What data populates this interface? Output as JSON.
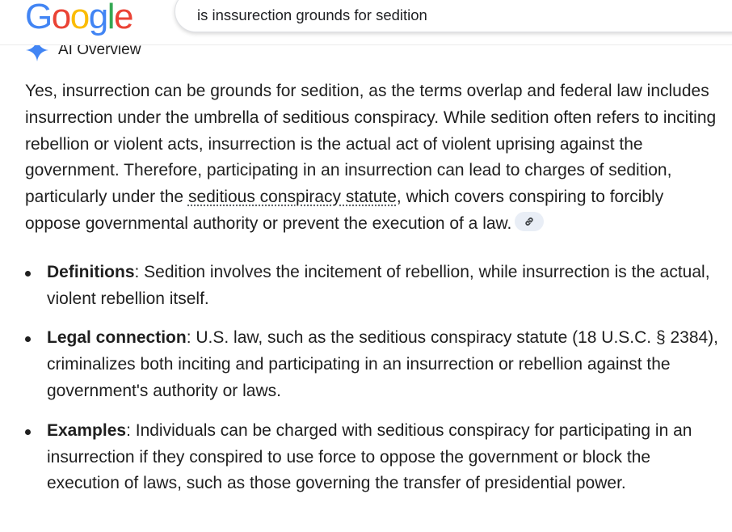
{
  "logo": {
    "letters": [
      {
        "char": "G",
        "color": "#4285F4"
      },
      {
        "char": "o",
        "color": "#EA4335"
      },
      {
        "char": "o",
        "color": "#FBBC05"
      },
      {
        "char": "g",
        "color": "#4285F4"
      },
      {
        "char": "l",
        "color": "#34A853"
      },
      {
        "char": "e",
        "color": "#EA4335"
      }
    ]
  },
  "search": {
    "query": "is inssurection grounds for sedition"
  },
  "ai_overview": {
    "title": "AI Overview",
    "icon": "sparkle-icon",
    "intro": {
      "text_before": "Yes, insurrection can be grounds for sedition, as the terms overlap and federal law includes insurrection under the umbrella of seditious conspiracy. While sedition often refers to inciting rebellion or violent acts, insurrection is the actual act of violent uprising against the government. Therefore, participating in an insurrection can lead to charges of sedition, particularly under the ",
      "link_text": "seditious conspiracy statute",
      "text_after": ", which covers conspiring to forcibly oppose governmental authority or prevent the execution of a law.",
      "chip_icon": "link-icon"
    },
    "bullets": [
      {
        "term": "Definitions",
        "text": ": Sedition involves the incitement of rebellion, while insurrection is the actual, violent rebellion itself."
      },
      {
        "term": "Legal connection",
        "text": ": U.S. law, such as the seditious conspiracy statute (18 U.S.C. § 2384), criminalizes both inciting and participating in an insurrection or rebellion against the government's authority or laws."
      },
      {
        "term": "Examples",
        "text": ": Individuals can be charged with seditious conspiracy for participating in an insurrection if they conspired to use force to oppose the government or block the execution of laws, such as those governing the transfer of presidential power."
      }
    ]
  },
  "colors": {
    "text": "#1f1f1f",
    "chip_bg": "#e9eef6",
    "sparkle": "#4285F4"
  }
}
